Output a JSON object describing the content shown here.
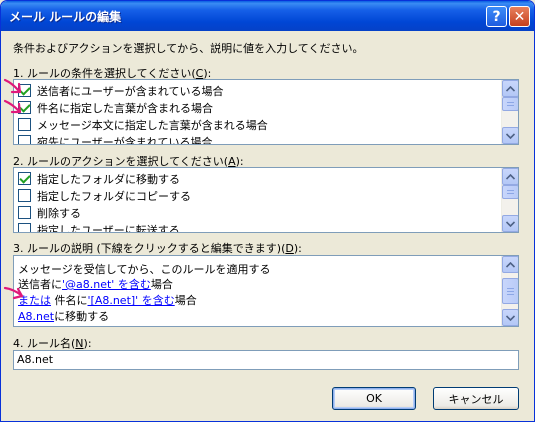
{
  "window": {
    "title": "メール ルールの編集",
    "help_glyph": "?",
    "close_glyph": "✕"
  },
  "instruction": "条件およびアクションを選択してから、説明に値を入力してください。",
  "section1": {
    "label_pre": "1. ルールの条件を選択してください(",
    "label_key": "C",
    "label_post": "):",
    "items": [
      {
        "label": "送信者にユーザーが含まれている場合",
        "checked": true
      },
      {
        "label": "件名に指定した言葉が含まれる場合",
        "checked": true
      },
      {
        "label": "メッセージ本文に指定した言葉が含まれる場合",
        "checked": false
      },
      {
        "label": "宛先にユーザーが含まれている場合",
        "checked": false
      }
    ]
  },
  "section2": {
    "label_pre": "2. ルールのアクションを選択してください(",
    "label_key": "A",
    "label_post": "):",
    "items": [
      {
        "label": "指定したフォルダに移動する",
        "checked": true
      },
      {
        "label": "指定したフォルダにコピーする",
        "checked": false
      },
      {
        "label": "削除する",
        "checked": false
      },
      {
        "label": "指定したユーザーに転送する",
        "checked": false
      }
    ]
  },
  "section3": {
    "label_pre": "3. ルールの説明 (下線をクリックすると編集できます)(",
    "label_key": "D",
    "label_post": "):",
    "line1": "メッセージを受信してから、このルールを適用する",
    "line2_pre": "送信者に",
    "line2_link": "'@a8.net' を含む",
    "line2_post": "場合",
    "line3_link_or": "または",
    "line3_mid": " 件名に",
    "line3_link": "'[A8.net]' を含む",
    "line3_post": "場合",
    "line4_link": "A8.net",
    "line4_post": "に移動する"
  },
  "section4": {
    "label_pre": "4. ルール名(",
    "label_key": "N",
    "label_post": "):",
    "value": "A8.net"
  },
  "buttons": {
    "ok": "OK",
    "cancel": "キャンセル"
  },
  "colors": {
    "annotation_arrow": "#E0197A",
    "link": "#0000FF"
  }
}
